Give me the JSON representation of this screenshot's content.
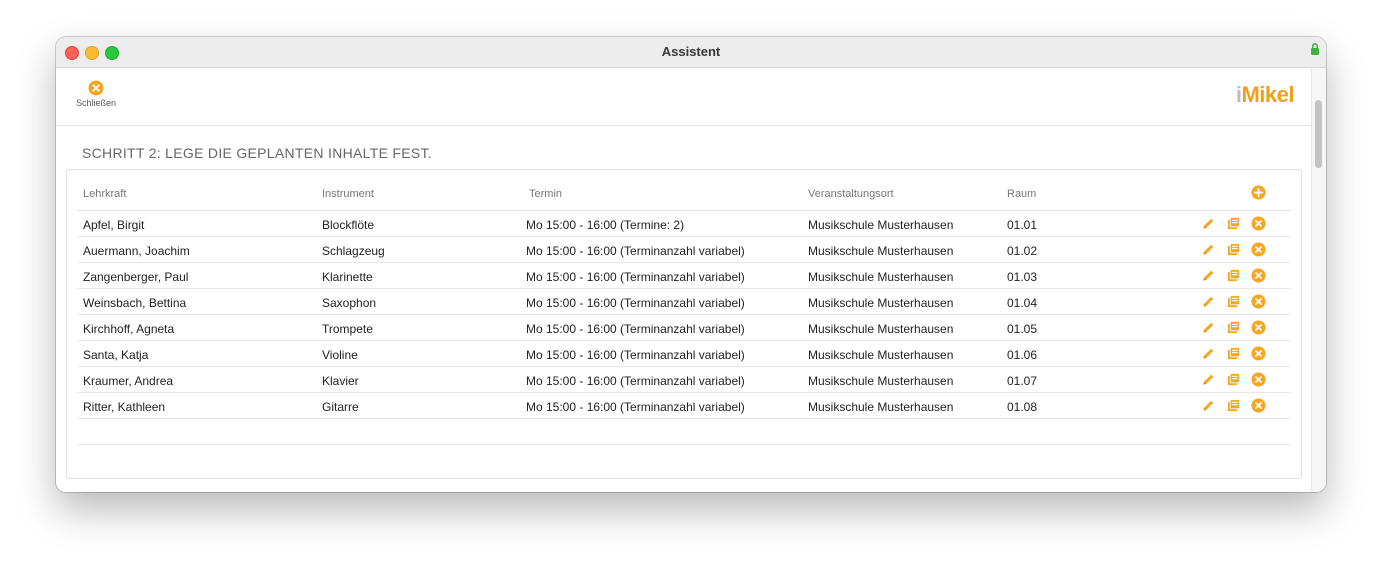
{
  "window": {
    "title": "Assistent"
  },
  "toolbar": {
    "close_label": "Schließen"
  },
  "logo": {
    "text_i": "i",
    "text_rest": "Mikel"
  },
  "heading": "SCHRITT 2: LEGE DIE GEPLANTEN INHALTE FEST.",
  "table": {
    "columns": [
      "Lehrkraft",
      "Instrument",
      "Termin",
      "Veranstaltungsort",
      "Raum"
    ],
    "rows": [
      [
        "Apfel, Birgit",
        "Blockflöte",
        "Mo 15:00 - 16:00 (Termine: 2)",
        "Musikschule Musterhausen",
        "01.01"
      ],
      [
        "Auermann, Joachim",
        "Schlagzeug",
        "Mo 15:00 - 16:00 (Terminanzahl variabel)",
        "Musikschule Musterhausen",
        "01.02"
      ],
      [
        "Zangenberger, Paul",
        "Klarinette",
        "Mo 15:00 - 16:00 (Terminanzahl variabel)",
        "Musikschule Musterhausen",
        "01.03"
      ],
      [
        "Weinsbach, Bettina",
        "Saxophon",
        "Mo 15:00 - 16:00 (Terminanzahl variabel)",
        "Musikschule Musterhausen",
        "01.04"
      ],
      [
        "Kirchhoff, Agneta",
        "Trompete",
        "Mo 15:00 - 16:00 (Terminanzahl variabel)",
        "Musikschule Musterhausen",
        "01.05"
      ],
      [
        "Santa, Katja",
        "Violine",
        "Mo 15:00 - 16:00 (Terminanzahl variabel)",
        "Musikschule Musterhausen",
        "01.06"
      ],
      [
        "Kraumer, Andrea",
        "Klavier",
        "Mo 15:00 - 16:00 (Terminanzahl variabel)",
        "Musikschule Musterhausen",
        "01.07"
      ],
      [
        "Ritter, Kathleen",
        "Gitarre",
        "Mo 15:00 - 16:00 (Terminanzahl variabel)",
        "Musikschule Musterhausen",
        "01.08"
      ]
    ]
  },
  "icons": {
    "close": "close-circle-icon",
    "add": "plus-circle-icon",
    "edit": "pencil-icon",
    "copy": "copy-icon",
    "delete": "delete-circle-icon",
    "lock": "lock-icon"
  },
  "colors": {
    "accent": "#f5a623",
    "heading": "#666666"
  }
}
